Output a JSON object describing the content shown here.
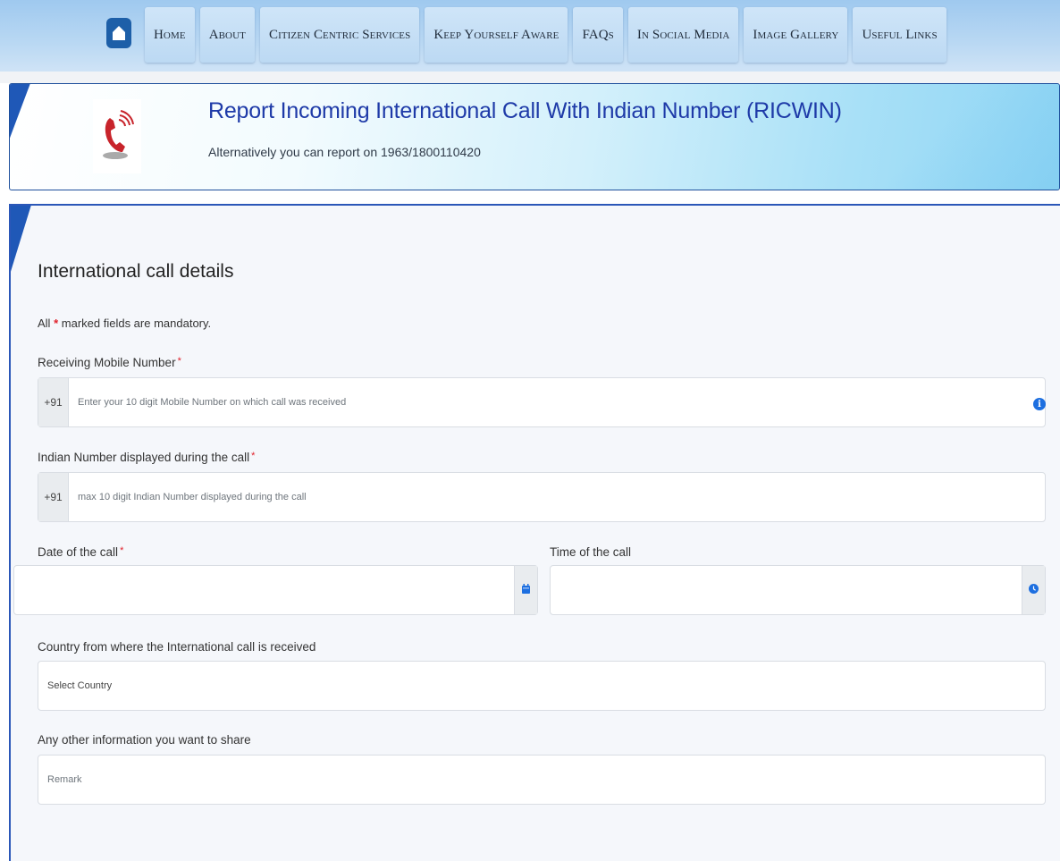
{
  "nav": {
    "items": [
      {
        "label": "Home"
      },
      {
        "label": "About"
      },
      {
        "label": "Citizen Centric Services"
      },
      {
        "label": "Keep Yourself Aware"
      },
      {
        "label": "FAQs"
      },
      {
        "label": "In Social Media"
      },
      {
        "label": "Image Gallery"
      },
      {
        "label": "Useful Links"
      }
    ]
  },
  "banner": {
    "title": "Report Incoming International Call With Indian Number (RICWIN)",
    "subtitle": "Alternatively you can report on 1963/1800110420",
    "icon": "phone-ringing-icon"
  },
  "form": {
    "section_title": "International call details",
    "mandatory_prefix": "All",
    "mandatory_star": "*",
    "mandatory_suffix": "marked fields are mandatory.",
    "required_marker": "*",
    "receiving_mobile": {
      "label": "Receiving Mobile Number",
      "prefix": "+91",
      "placeholder": "Enter your 10 digit Mobile Number on which call was received",
      "value": ""
    },
    "indian_number": {
      "label": "Indian Number displayed during the call",
      "prefix": "+91",
      "placeholder": "max 10 digit Indian Number displayed during the call",
      "value": ""
    },
    "call_date": {
      "label": "Date of the call",
      "value": ""
    },
    "call_time": {
      "label": "Time of the call",
      "value": ""
    },
    "country": {
      "label": "Country from where the International call is received",
      "selected": "Select Country"
    },
    "remark": {
      "label": "Any other information you want to share",
      "placeholder": "Remark",
      "value": ""
    }
  },
  "colors": {
    "accent": "#1f58b7",
    "title_blue": "#1e3aa8",
    "required_red": "#e0202a",
    "icon_blue": "#1d6fe0"
  }
}
